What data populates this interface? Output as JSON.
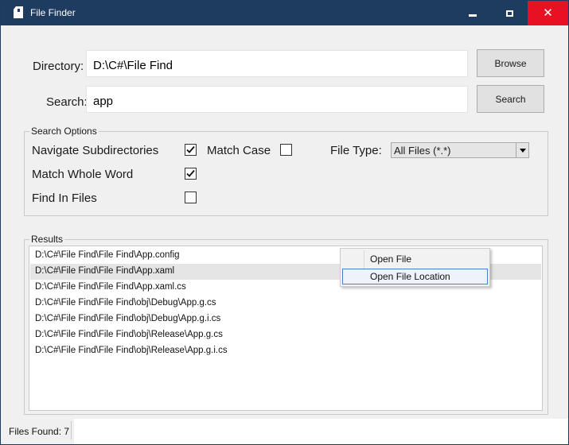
{
  "window": {
    "title": "File Finder",
    "icon": "file-icon",
    "controls": {
      "minimize": "minimize-icon",
      "maximize": "maximize-icon",
      "close": "close-icon"
    }
  },
  "form": {
    "directory_label": "Directory:",
    "directory_value": "D:\\C#\\File Find",
    "browse_label": "Browse",
    "search_label": "Search:",
    "search_value": "app",
    "search_button_label": "Search"
  },
  "search_options": {
    "title": "Search Options",
    "navigate_subdirectories": {
      "label": "Navigate Subdirectories",
      "checked": true
    },
    "match_case": {
      "label": "Match Case",
      "checked": false
    },
    "match_whole_word": {
      "label": "Match Whole Word",
      "checked": true
    },
    "find_in_files": {
      "label": "Find In Files",
      "checked": false
    },
    "file_type_label": "File Type:",
    "file_type_value": "All Files (*.*)"
  },
  "results": {
    "title": "Results",
    "items": [
      "D:\\C#\\File Find\\File Find\\App.config",
      "D:\\C#\\File Find\\File Find\\App.xaml",
      "D:\\C#\\File Find\\File Find\\App.xaml.cs",
      "D:\\C#\\File Find\\File Find\\obj\\Debug\\App.g.cs",
      "D:\\C#\\File Find\\File Find\\obj\\Debug\\App.g.i.cs",
      "D:\\C#\\File Find\\File Find\\obj\\Release\\App.g.cs",
      "D:\\C#\\File Find\\File Find\\obj\\Release\\App.g.i.cs"
    ],
    "hovered_index": 1
  },
  "context_menu": {
    "items": [
      "Open File",
      "Open File Location"
    ],
    "highlighted_index": 1
  },
  "status": {
    "files_found": "Files Found: 7"
  },
  "colors": {
    "titlebar": "#1e3b60",
    "close_hover": "#e81123",
    "menu_highlight_border": "#4a7ecb"
  }
}
